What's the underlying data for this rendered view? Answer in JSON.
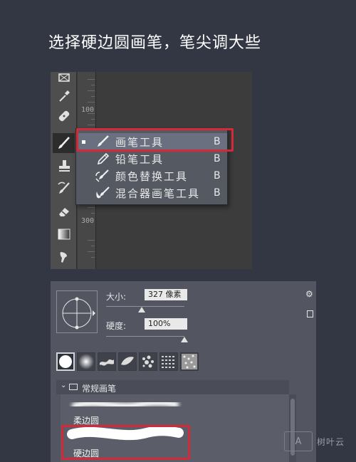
{
  "title": "选择硬边圆画笔，笔尖调大些",
  "ruler": {
    "top_number": "100",
    "bottom_number": "300"
  },
  "flyout": {
    "items": [
      {
        "label": "画笔工具",
        "key": "B",
        "icon": "brush-icon",
        "selected": true
      },
      {
        "label": "铅笔工具",
        "key": "B",
        "icon": "pencil-icon",
        "selected": false
      },
      {
        "label": "颜色替换工具",
        "key": "B",
        "icon": "color-replace-icon",
        "selected": false
      },
      {
        "label": "混合器画笔工具",
        "key": "B",
        "icon": "mixer-brush-icon",
        "selected": false
      }
    ]
  },
  "brush_panel": {
    "size_label": "大小:",
    "size_value": "327 像素",
    "hardness_label": "硬度:",
    "hardness_value": "100%",
    "size_fraction": 0.45,
    "hardness_fraction": 1.0,
    "folder_label": "常规画笔",
    "brushes": [
      {
        "name": "柔边圆"
      },
      {
        "name": "硬边圆"
      }
    ]
  },
  "watermark": {
    "logo_text": "A",
    "text": "树叶云"
  },
  "accent_color": "#d32a3a"
}
